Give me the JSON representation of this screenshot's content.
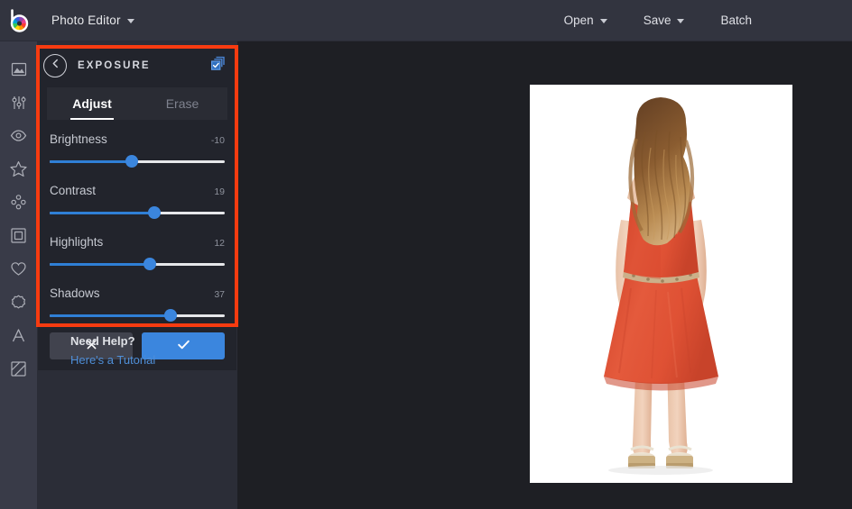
{
  "app": {
    "logo_icon": "bepic-color-wheel-logo",
    "menu_label": "Photo Editor"
  },
  "toolbar": {
    "open_label": "Open",
    "save_label": "Save",
    "batch_label": "Batch"
  },
  "rail": {
    "items": [
      {
        "name": "sidebar-item-image",
        "icon": "image-mountain-icon"
      },
      {
        "name": "sidebar-item-adjust",
        "icon": "sliders-adjust-icon"
      },
      {
        "name": "sidebar-item-retouch",
        "icon": "eye-icon"
      },
      {
        "name": "sidebar-item-effects",
        "icon": "star-icon"
      },
      {
        "name": "sidebar-item-beauty",
        "icon": "dots-cluster-icon"
      },
      {
        "name": "sidebar-item-frames",
        "icon": "square-frame-icon"
      },
      {
        "name": "sidebar-item-overlays",
        "icon": "heart-icon"
      },
      {
        "name": "sidebar-item-stickers",
        "icon": "badge-burst-icon"
      },
      {
        "name": "sidebar-item-text",
        "icon": "text-letter-a-icon"
      },
      {
        "name": "sidebar-item-texture",
        "icon": "diagonal-stripes-square-icon"
      }
    ]
  },
  "panel": {
    "back_icon": "back-arrow-circle-icon",
    "title": "EXPOSURE",
    "duplicate_icon": "duplicate-layers-checked-icon",
    "tabs": [
      {
        "label": "Adjust",
        "active": true
      },
      {
        "label": "Erase",
        "active": false
      }
    ],
    "sliders": [
      {
        "label": "Brightness",
        "value": "-10",
        "percent": 47
      },
      {
        "label": "Contrast",
        "value": "19",
        "percent": 60
      },
      {
        "label": "Highlights",
        "value": "12",
        "percent": 57
      },
      {
        "label": "Shadows",
        "value": "37",
        "percent": 69
      }
    ],
    "cancel_icon": "close-x-icon",
    "apply_icon": "checkmark-icon"
  },
  "help": {
    "title": "Need Help?",
    "link_label": "Here's a Tutorial"
  },
  "canvas": {
    "photo_alt": "woman-in-coral-dress-back-view-on-white-background"
  },
  "colors": {
    "accent_blue": "#3b86de",
    "highlight_red": "#f73b10",
    "topbar_bg": "#32343f",
    "rail_bg": "#393b48",
    "panel_bg": "#2b2d37",
    "edit_panel_bg": "#22242c",
    "canvas_bg": "#1e1f24",
    "dress_coral": "#e0543a"
  }
}
